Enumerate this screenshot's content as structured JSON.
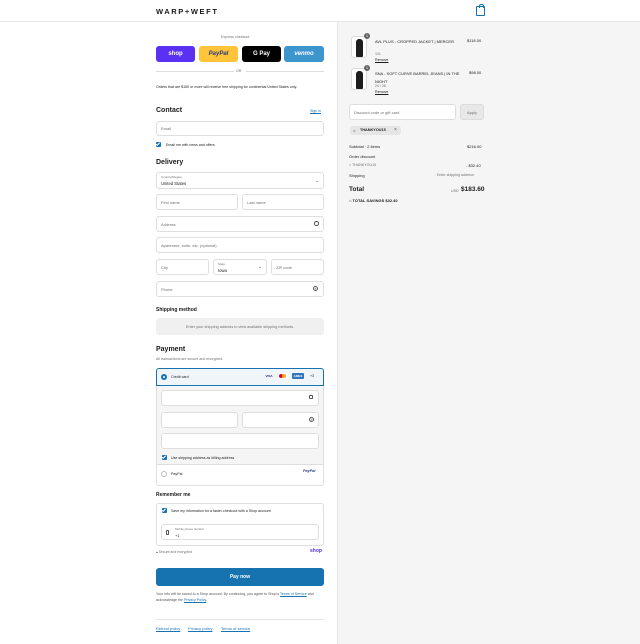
{
  "header": {
    "brand": "WARP+WEFT",
    "cart_icon": "shopping-bag-icon",
    "accent": "#1773b0"
  },
  "express": {
    "title": "Express checkout",
    "buttons": [
      {
        "label": "shop",
        "color": "#5a31f4"
      },
      {
        "label": "PayPal",
        "color": "#ffc439"
      },
      {
        "label": "G Pay",
        "color": "#000000"
      },
      {
        "label": "venmo",
        "color": "#3d95ce"
      }
    ],
    "or": "OR"
  },
  "notice": "Orders that are $150 or more will receive free shipping for continental United States only.",
  "contact": {
    "title": "Contact",
    "signin": "Sign in",
    "email_placeholder": "Email",
    "news_label": "Email me with news and offers"
  },
  "delivery": {
    "title": "Delivery",
    "country_label": "Country/Region",
    "country_value": "United States",
    "first_name": "First name",
    "last_name": "Last name",
    "address": "Address",
    "apartment": "Apartment, suite, etc. (optional)",
    "city": "City",
    "state_label": "State",
    "state_value": "Iowa",
    "zip": "ZIP code",
    "phone": "Phone"
  },
  "shipping": {
    "title": "Shipping method",
    "message": "Enter your shipping address to view available shipping methods."
  },
  "payment": {
    "title": "Payment",
    "subtitle": "All transactions are secure and encrypted.",
    "credit_card": "Credit card",
    "cards": [
      "VISA",
      "MC",
      "AMEX"
    ],
    "more_cards": "+3",
    "billing_label": "Use shipping address as billing address",
    "paypal_label": "PayPal",
    "paypal_logo": "PayPal"
  },
  "remember": {
    "title": "Remember me",
    "save_label": "Save my information for a faster checkout with a Shop account",
    "mobile_label": "Mobile phone number",
    "mobile_value": "+1",
    "secure": "Secure and encrypted",
    "shop_logo": "shop"
  },
  "pay_now": "Pay now",
  "legal": {
    "text1": "Your info will be saved to a Shop account. By continuing, you agree to Shop's",
    "terms": "Terms of Service",
    "and": "and acknowledge the",
    "privacy": "Privacy Policy",
    "end": "."
  },
  "footer": [
    "Refund policy",
    "Privacy policy",
    "Terms of service"
  ],
  "order": {
    "items": [
      {
        "qty": "1",
        "name": "AVL PLUS - CROPPED JACKET | MERCER",
        "variant": "1XL",
        "remove": "Remove",
        "price": "$118.00"
      },
      {
        "qty": "1",
        "name": "SNA - SOFT CURVE BARREL JEANS | IN THE NIGHT",
        "variant": "24 / 26",
        "remove": "Remove",
        "price": "$98.00"
      }
    ],
    "discount_placeholder": "Discount code or gift card",
    "apply": "Apply",
    "code_tag": "THANKYOU15",
    "subtotal_label": "Subtotal · 2 items",
    "subtotal_value": "$216.00",
    "order_discount_label": "Order discount",
    "discount_code": "THANKYOU15",
    "discount_value": "- $32.40",
    "shipping_label": "Shipping",
    "shipping_value": "Enter shipping address",
    "total_label": "Total",
    "currency": "USD",
    "total_value": "$183.60",
    "savings_label": "TOTAL SAVINGS",
    "savings_value": "$32.40"
  }
}
